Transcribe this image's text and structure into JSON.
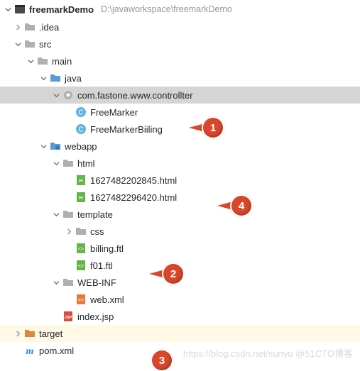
{
  "root": {
    "name": "freemarkDemo",
    "path": "D:\\javaworkspace\\freemarkDemo"
  },
  "nodes": {
    "idea": ".idea",
    "src": "src",
    "main": "main",
    "java": "java",
    "pkg": "com.fastone.www.controllter",
    "cls1": "FreeMarker",
    "cls2": "FreeMarkerBiiling",
    "webapp": "webapp",
    "html": "html",
    "h1": "1627482202845.html",
    "h2": "1627482296420.html",
    "template": "template",
    "css": "css",
    "ftl1": "billing.ftl",
    "ftl2": "f01.ftl",
    "webinf": "WEB-INF",
    "webxml": "web.xml",
    "indexjsp": "index.jsp",
    "target": "target",
    "pom": "pom.xml"
  },
  "annotations": {
    "a1": "1",
    "a2": "2",
    "a3": "3",
    "a4": "4"
  },
  "watermark": "https://blog.csdn.net/sunyu    @51CTO博客"
}
